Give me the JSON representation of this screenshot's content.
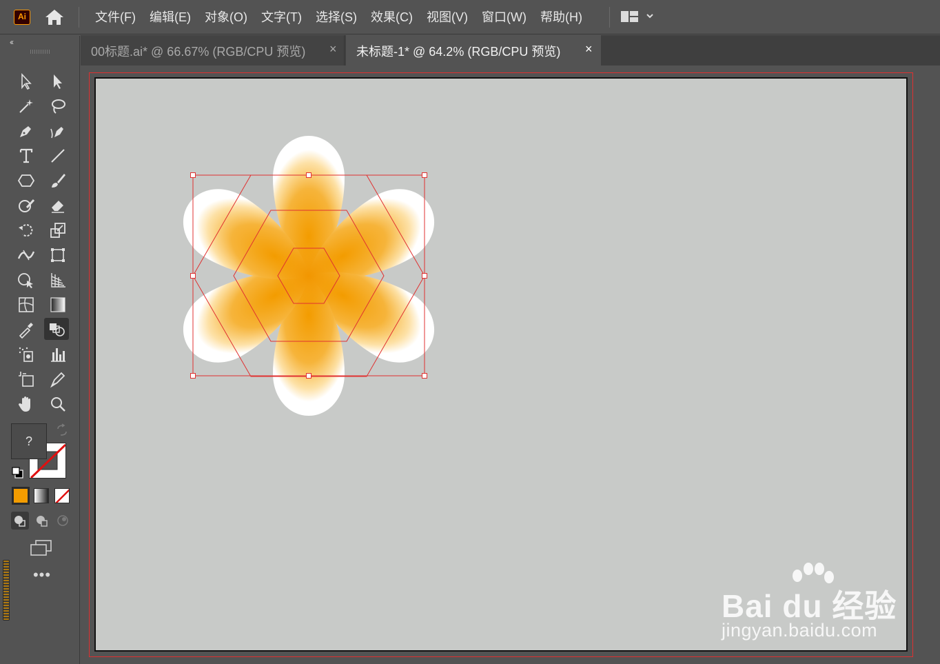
{
  "app": {
    "logo_text": "Ai"
  },
  "menu": {
    "items": [
      "文件(F)",
      "编辑(E)",
      "对象(O)",
      "文字(T)",
      "选择(S)",
      "效果(C)",
      "视图(V)",
      "窗口(W)",
      "帮助(H)"
    ]
  },
  "tabs": [
    {
      "label": "00标题.ai* @ 66.67% (RGB/CPU 预览)",
      "close": "×",
      "active": false
    },
    {
      "label": "未标题-1* @ 64.2% (RGB/CPU 预览)",
      "close": "×",
      "active": true
    }
  ],
  "toolbar": {
    "collapse_label": "‹‹",
    "fill_label": "?",
    "more_label": "•••",
    "tools": [
      "selection-tool",
      "direct-selection-tool",
      "magic-wand-tool",
      "lasso-tool",
      "pen-tool",
      "curvature-tool",
      "type-tool",
      "line-segment-tool",
      "polygon-tool",
      "paintbrush-tool",
      "shaper-tool",
      "eraser-tool",
      "rotate-tool",
      "scale-tool",
      "width-tool",
      "free-transform-tool",
      "shape-builder-tool",
      "perspective-grid-tool",
      "mesh-tool",
      "gradient-tool",
      "eyedropper-tool",
      "blend-tool",
      "symbol-sprayer-tool",
      "column-graph-tool",
      "artboard-tool",
      "slice-tool",
      "hand-tool",
      "zoom-tool"
    ],
    "active_tool": "blend-tool"
  },
  "colors": {
    "petal_center": "#f39c00",
    "petal_edge": "#ffffff",
    "selection": "#e03030",
    "accent": "#ff9a00"
  },
  "watermark": {
    "brand": "Bai du 经验",
    "url": "jingyan.baidu.com"
  }
}
